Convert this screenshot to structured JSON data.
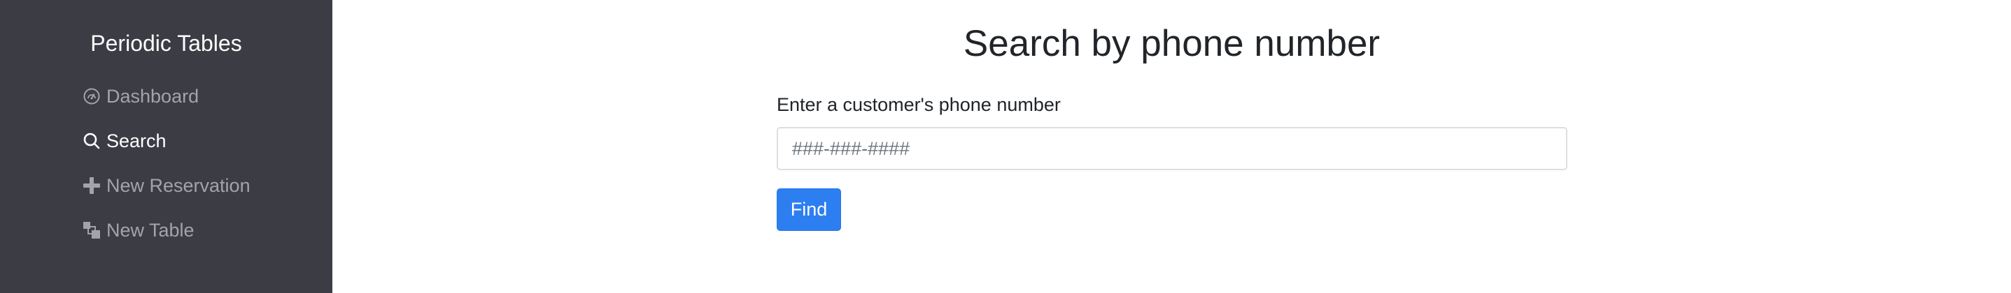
{
  "sidebar": {
    "brand": "Periodic Tables",
    "items": [
      {
        "label": "Dashboard",
        "icon": "dashboard-icon",
        "active": false
      },
      {
        "label": "Search",
        "icon": "search-icon",
        "active": true
      },
      {
        "label": "New Reservation",
        "icon": "plus-icon",
        "active": false
      },
      {
        "label": "New Table",
        "icon": "layers-icon",
        "active": false
      }
    ]
  },
  "main": {
    "title": "Search by phone number",
    "form": {
      "label": "Enter a customer's phone number",
      "phone_placeholder": "###-###-####",
      "phone_value": "",
      "find_label": "Find"
    }
  },
  "colors": {
    "sidebar_bg": "#3c3c45",
    "nav_inactive": "#a3a4aa",
    "nav_active": "#ffffff",
    "primary": "#2d7ef0"
  }
}
